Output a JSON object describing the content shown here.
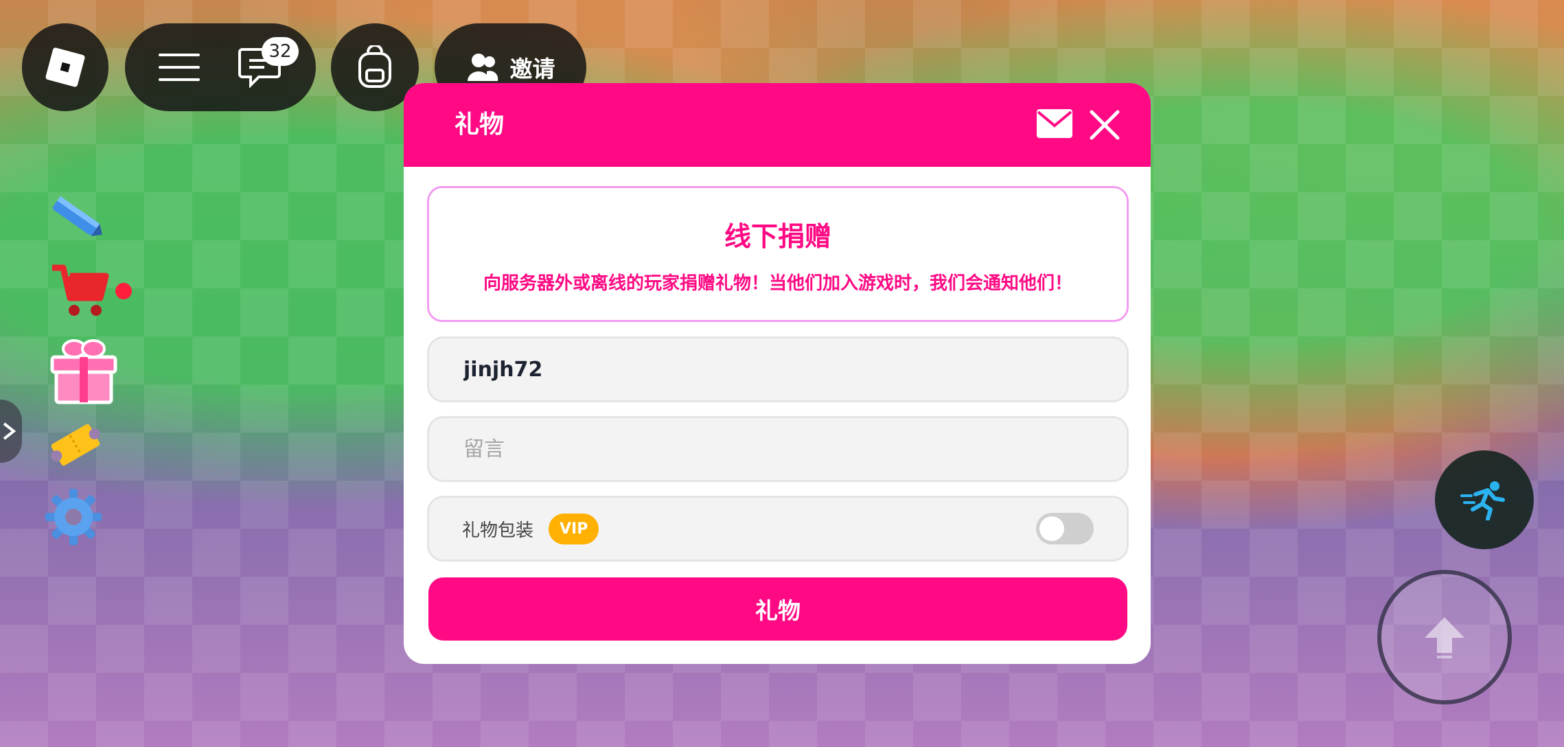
{
  "topbar": {
    "chat_badge": "32",
    "invite_label": "邀请"
  },
  "dialog": {
    "title": "礼物",
    "info_title": "线下捐赠",
    "info_text": "向服务器外或离线的玩家捐赠礼物！当他们加入游戏时，我们会通知他们！",
    "recipient_value": "jinjh72",
    "message_placeholder": "留言",
    "giftwrap_label": "礼物包装",
    "vip_badge": "VIP",
    "giftwrap_enabled": false,
    "submit_label": "礼物"
  },
  "colors": {
    "accent": "#ff0a84",
    "vip": "#ffb000",
    "info_border": "#f29cf0"
  },
  "icons": {
    "sidebar": [
      "pencil-icon",
      "cart-icon",
      "gift-icon",
      "ticket-icon",
      "gear-icon"
    ],
    "controls": [
      "sprint-icon",
      "jump-arrow-icon"
    ]
  }
}
